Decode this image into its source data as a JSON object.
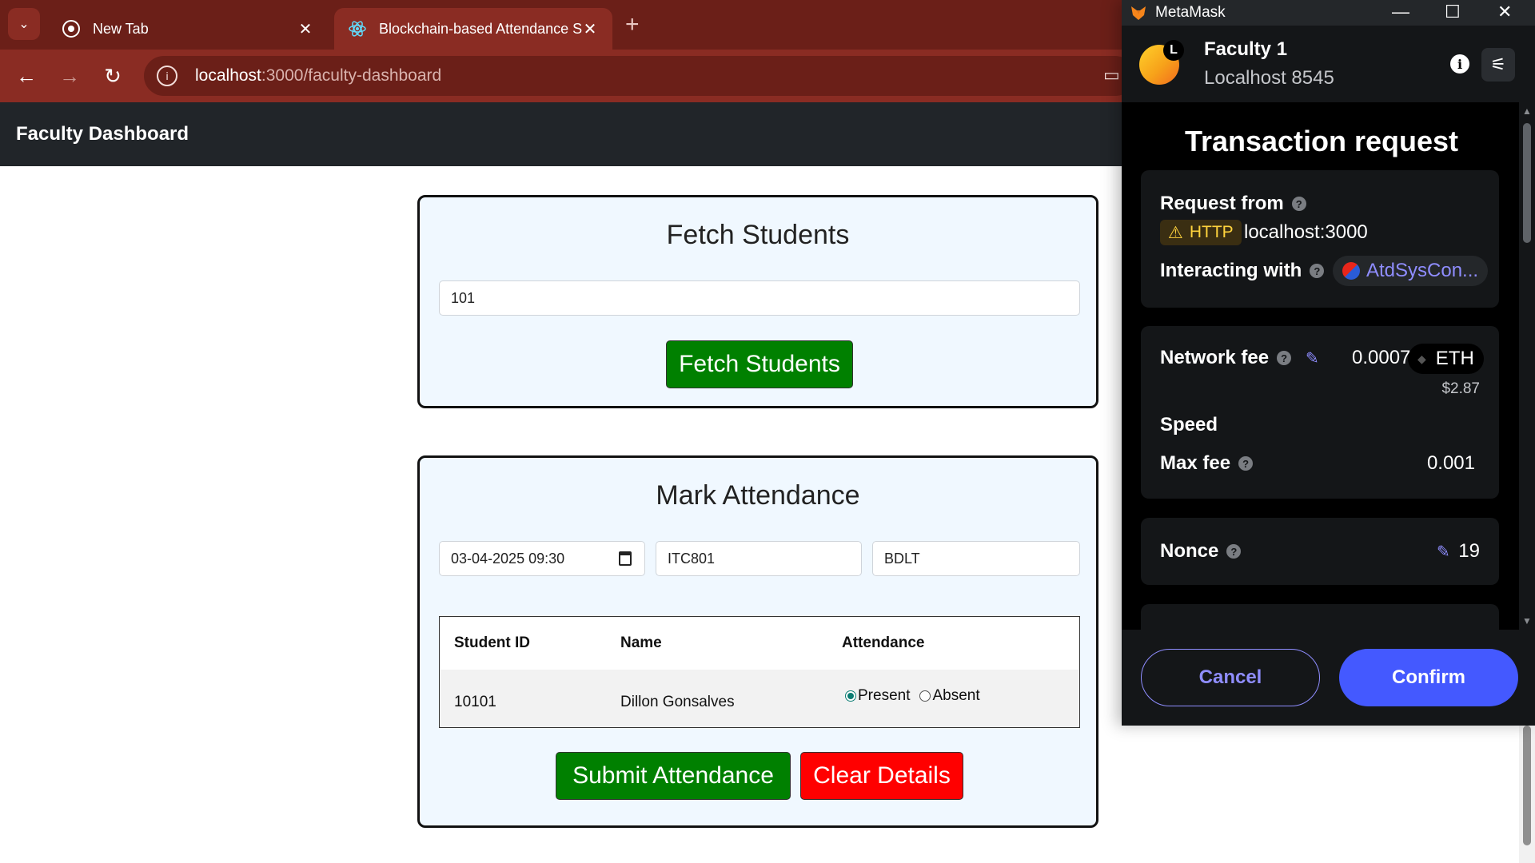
{
  "browser": {
    "tabs": [
      {
        "label": "New Tab",
        "icon": "chrome-icon"
      },
      {
        "label": "Blockchain-based Attendance S",
        "icon": "react-icon"
      }
    ],
    "url_host": "localhost",
    "url_path": ":3000/faculty-dashboard",
    "colors": {
      "frame": "#6b1f18",
      "toolbar": "#8a2c23"
    }
  },
  "app": {
    "title": "Faculty Dashboard",
    "fetch": {
      "heading": "Fetch Students",
      "class_input_value": "101",
      "button": "Fetch Students"
    },
    "attendance": {
      "heading": "Mark Attendance",
      "datetime_value": "03-04-2025 09:30",
      "subject_code_value": "ITC801",
      "subject_name_value": "BDLT",
      "table": {
        "headers": [
          "Student ID",
          "Name",
          "Attendance"
        ],
        "rows": [
          {
            "id": "10101",
            "name": "Dillon Gonsalves",
            "present_label": "Present",
            "absent_label": "Absent",
            "selected": "Present"
          }
        ]
      },
      "submit_button": "Submit Attendance",
      "clear_button": "Clear Details"
    },
    "colors": {
      "card_bg": "#f0f8ff",
      "green": "#008000",
      "red": "#ff0000",
      "appbar": "#212529"
    }
  },
  "metamask": {
    "window_title": "MetaMask",
    "account_badge": "L",
    "account_name": "Faculty 1",
    "network": "Localhost 8545",
    "heading": "Transaction request",
    "request_from_label": "Request from",
    "http_badge": "HTTP",
    "request_origin": "localhost:3000",
    "interacting_label": "Interacting with",
    "contract": "AtdSysCon...",
    "network_fee_label": "Network fee",
    "network_fee_value": "0.0007",
    "currency": "ETH",
    "fee_usd": "$2.87",
    "speed_label": "Speed",
    "max_fee_label": "Max fee",
    "max_fee_value": "0.001",
    "nonce_label": "Nonce",
    "nonce_value": "19",
    "cancel": "Cancel",
    "confirm": "Confirm",
    "colors": {
      "bg": "#000000",
      "card": "#141618",
      "accent": "#4459ff",
      "link": "#8f8dff"
    }
  }
}
